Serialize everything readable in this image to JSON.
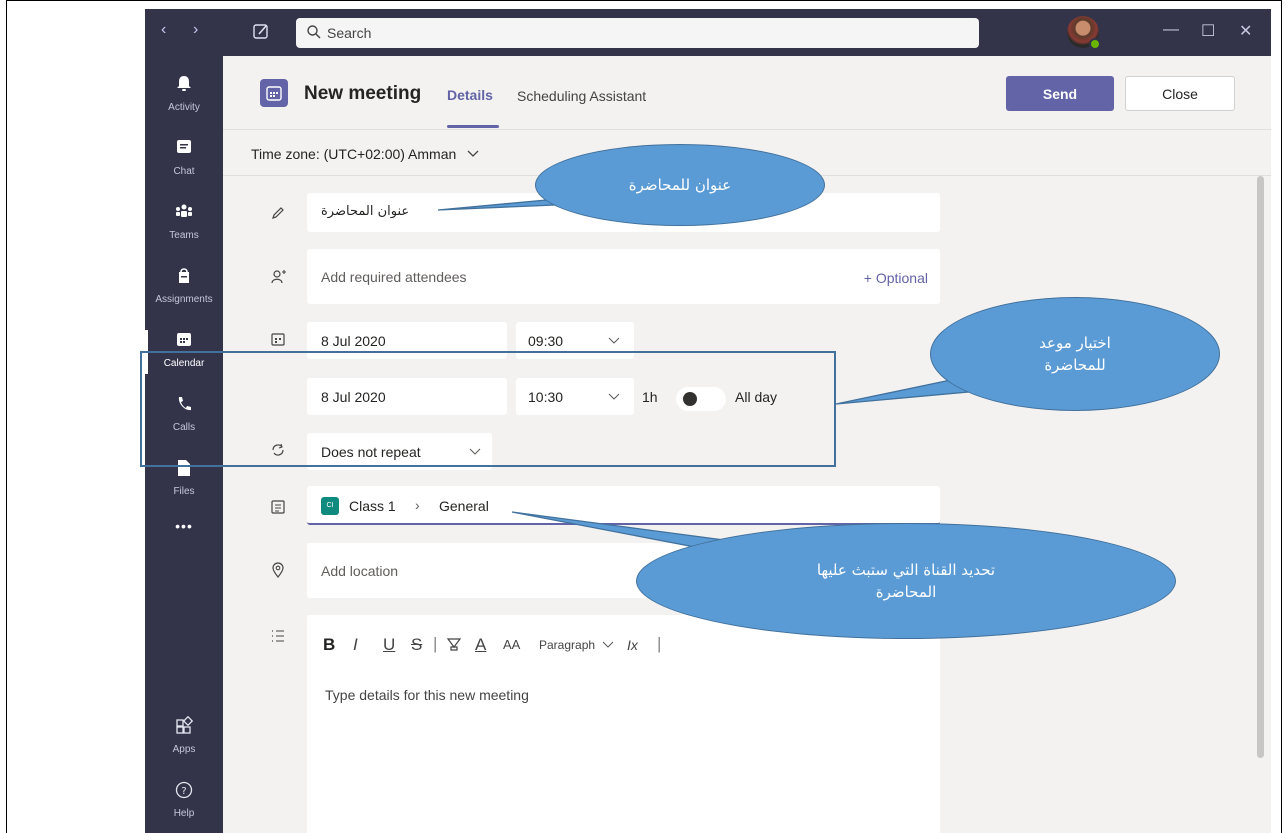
{
  "titlebar": {
    "search_placeholder": "Search",
    "back_glyph": "‹",
    "forward_glyph": "›",
    "minimize_glyph": "—",
    "maximize_glyph": "☐",
    "close_glyph": "✕"
  },
  "rail": {
    "items": [
      {
        "label": "Activity",
        "icon": "bell-icon"
      },
      {
        "label": "Chat",
        "icon": "chat-icon"
      },
      {
        "label": "Teams",
        "icon": "teams-icon"
      },
      {
        "label": "Assignments",
        "icon": "assignments-icon"
      },
      {
        "label": "Calendar",
        "icon": "calendar-icon"
      },
      {
        "label": "Calls",
        "icon": "phone-icon"
      },
      {
        "label": "Files",
        "icon": "files-icon"
      },
      {
        "label": "Apps",
        "icon": "apps-icon"
      },
      {
        "label": "Help",
        "icon": "help-icon"
      }
    ],
    "more_glyph": "•••"
  },
  "header": {
    "title": "New meeting",
    "tabs": [
      {
        "label": "Details"
      },
      {
        "label": "Scheduling Assistant"
      }
    ],
    "send_label": "Send",
    "close_label": "Close"
  },
  "form": {
    "timezone": "Time zone: (UTC+02:00) Amman",
    "title_value": "عنوان المحاضرة",
    "attendees_placeholder": "Add required attendees",
    "optional_label": "+ Optional",
    "start_date": "8 Jul 2020",
    "start_time": "09:30",
    "end_date": "8 Jul 2020",
    "end_time": "10:30",
    "duration": "1h",
    "all_day_label": "All day",
    "repeat_value": "Does not repeat",
    "channel_badge": "CI",
    "channel_team": "Class 1",
    "channel_sep": "›",
    "channel_name": "General",
    "location_placeholder": "Add location",
    "toolbar": {
      "bold": "B",
      "italic": "I",
      "underline": "U",
      "strike": "S",
      "sep": "|",
      "font_color": "A",
      "font_size": "AA",
      "paragraph": "Paragraph",
      "clear_format": "Ix",
      "trailing_sep": "|"
    },
    "details_placeholder": "Type details for this new meeting"
  },
  "annotations": {
    "title_callout": "عنوان للمحاضرة",
    "time_callout_line1": "اختيار موعد",
    "time_callout_line2": "للمحاضرة",
    "channel_callout_line1": "تحديد القناة التي ستبث عليها",
    "channel_callout_line2": "المحاضرة"
  }
}
